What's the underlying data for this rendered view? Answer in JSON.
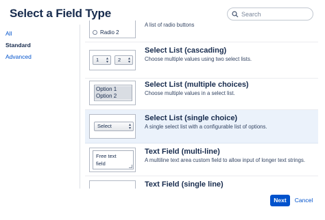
{
  "dialog": {
    "title": "Select a Field Type"
  },
  "search": {
    "placeholder": "Search",
    "value": ""
  },
  "sidebar": {
    "items": [
      {
        "label": "All",
        "active": false
      },
      {
        "label": "Standard",
        "active": true
      },
      {
        "label": "Advanced",
        "active": false
      }
    ]
  },
  "fields": [
    {
      "name": "",
      "description": "A list of radio buttons",
      "preview": {
        "radio_label": "Radio 2"
      }
    },
    {
      "name": "Select List (cascading)",
      "description": "Choose multiple values using two select lists.",
      "preview": {
        "left_value": "1",
        "right_value": "2"
      }
    },
    {
      "name": "Select List (multiple choices)",
      "description": "Choose multiple values in a select list.",
      "preview": {
        "options": [
          "Option 1",
          "Option 2"
        ]
      }
    },
    {
      "name": "Select List (single choice)",
      "description": "A single select list with a configurable list of options.",
      "selected": true,
      "preview": {
        "value": "Select"
      }
    },
    {
      "name": "Text Field (multi-line)",
      "description": "A multiline text area custom field to allow input of longer text strings.",
      "preview": {
        "text_line1": "Free text",
        "text_line2": "field"
      }
    },
    {
      "name": "Text Field (single line)",
      "description": ""
    }
  ],
  "footer": {
    "next_label": "Next",
    "cancel_label": "Cancel"
  },
  "colors": {
    "primary": "#0052cc",
    "selected_row": "#ebf2fb",
    "text": "#172b4d"
  }
}
